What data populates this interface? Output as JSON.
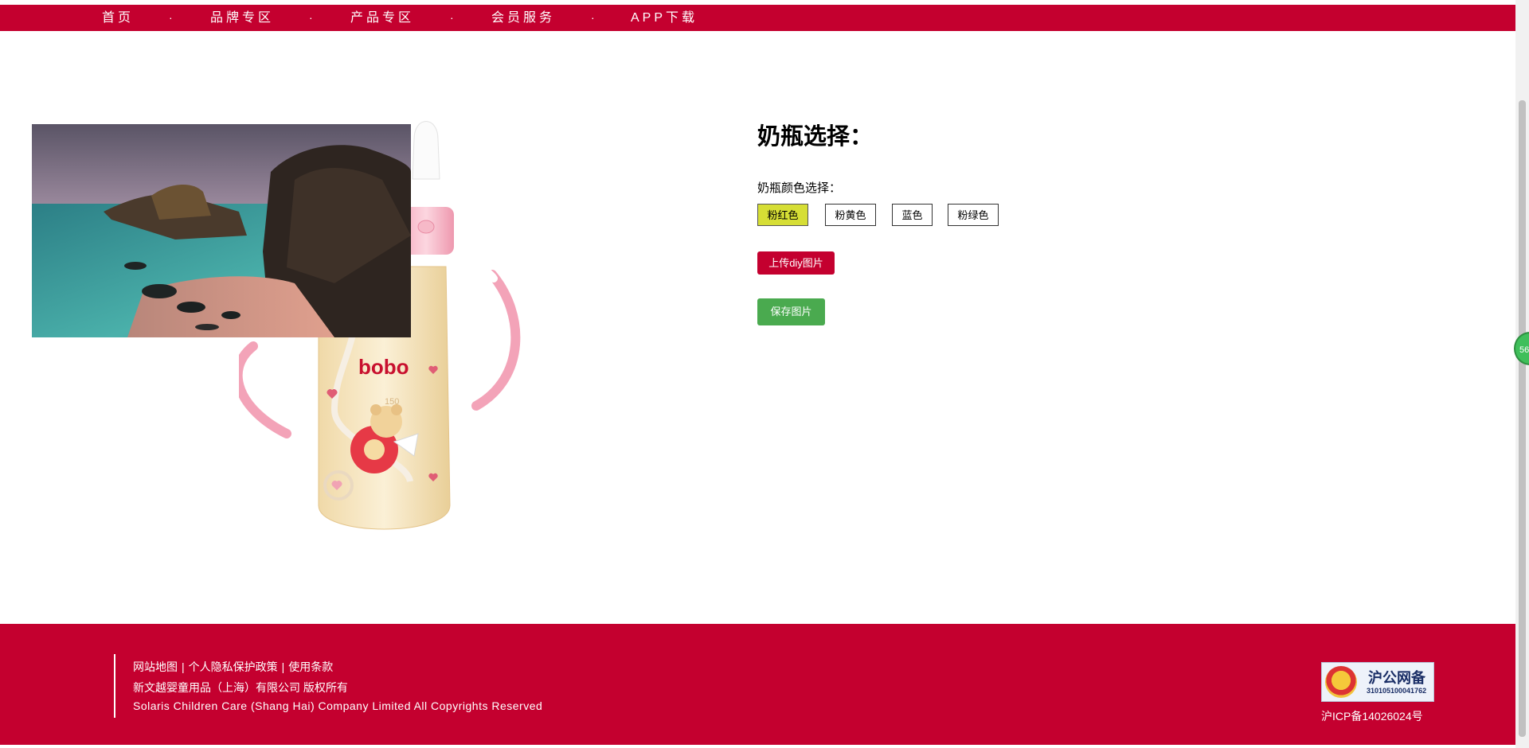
{
  "nav": {
    "items": [
      "首页",
      "品牌专区",
      "产品专区",
      "会员服务",
      "APP下载"
    ],
    "separator": "·"
  },
  "product": {
    "brand": "bobo",
    "capacity": "150",
    "select_title": "奶瓶选择：",
    "color_label": "奶瓶颜色选择：",
    "colors": [
      "粉红色",
      "粉黄色",
      "蓝色",
      "粉绿色"
    ],
    "selected_color": "粉红色",
    "upload_label": "上传diy图片",
    "save_label": "保存图片"
  },
  "footer": {
    "links": [
      "网站地图",
      "个人隐私保护政策",
      "使用条款"
    ],
    "link_separator": "|",
    "company": "新文越婴童用品（上海）有限公司 版权所有",
    "copyright": "Solaris Children Care (Shang Hai) Company Limited All Copyrights Reserved",
    "police_title": "沪公网备",
    "police_number": "310105100041762",
    "icp": "沪ICP备14026024号"
  },
  "float_badge": "56",
  "colors": {
    "brand_red": "#c4002f",
    "active_color_btn": "#d6de35",
    "save_green": "#4aaa4f"
  }
}
